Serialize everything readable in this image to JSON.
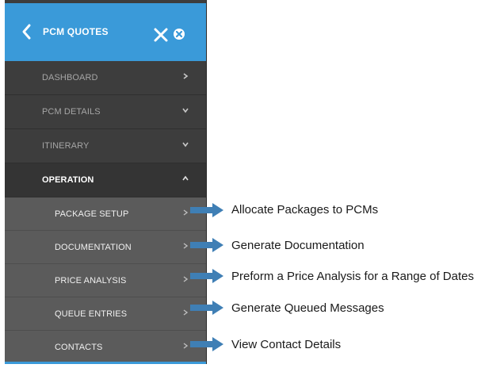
{
  "header": {
    "title": "PCM QUOTES",
    "accent_color": "#3a9ad9"
  },
  "menu": {
    "items": [
      {
        "label": "DASHBOARD",
        "chevron": "chevron-right-icon"
      },
      {
        "label": "PCM DETAILS",
        "chevron": "chevron-down-icon"
      },
      {
        "label": "ITINERARY",
        "chevron": "chevron-down-icon"
      },
      {
        "label": "OPERATION",
        "chevron": "chevron-up-icon",
        "active": true
      }
    ],
    "subitems": [
      {
        "label": "PACKAGE SETUP",
        "description": "Allocate Packages to PCMs"
      },
      {
        "label": "DOCUMENTATION",
        "description": "Generate Documentation"
      },
      {
        "label": "PRICE ANALYSIS",
        "description": "Preform a Price Analysis for a Range of Dates"
      },
      {
        "label": "QUEUE ENTRIES",
        "description": "Generate Queued Messages"
      },
      {
        "label": "CONTACTS",
        "description": "View Contact Details"
      }
    ]
  },
  "colors": {
    "panel": "#3d3d3d",
    "submenu": "#5b5b5b",
    "arrow": "#3f7fb5"
  }
}
